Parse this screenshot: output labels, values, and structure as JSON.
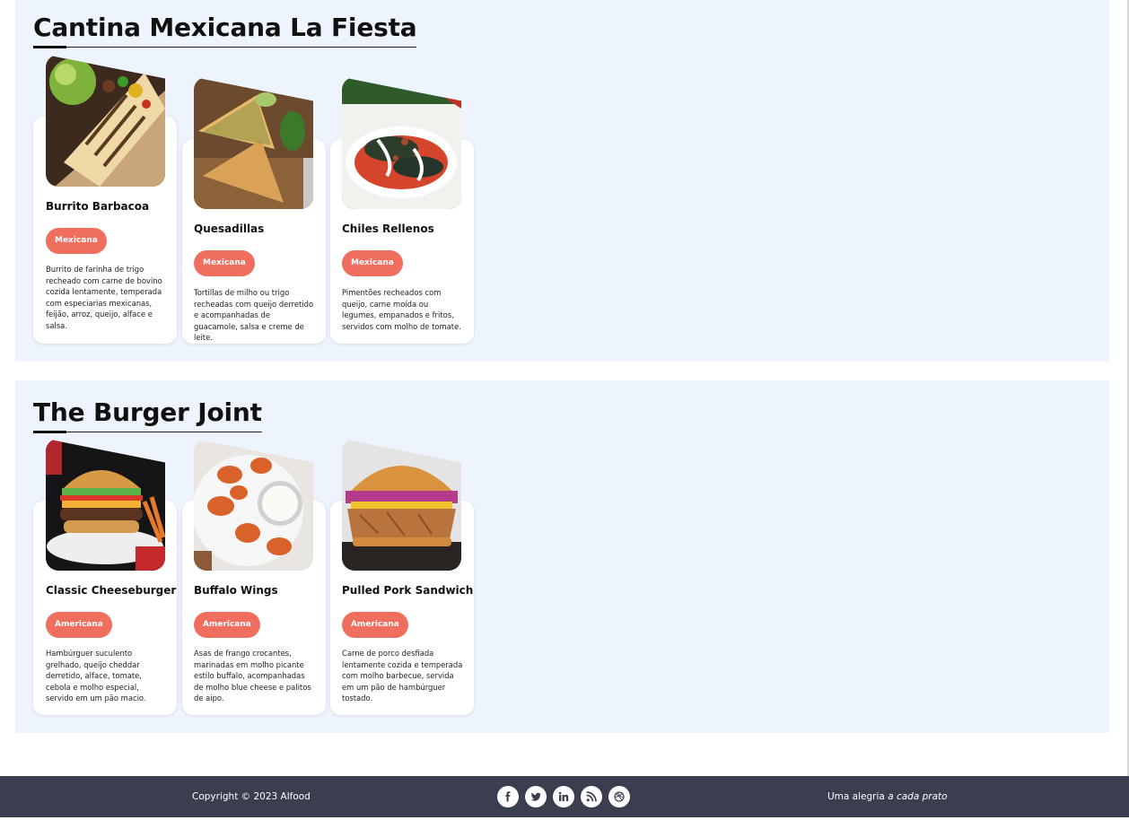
{
  "restaurants": [
    {
      "name": "Cantina Mexicana La Fiesta",
      "dishes": [
        {
          "name": "Burrito Barbacoa",
          "tag": "Mexicana",
          "description": "Burrito de farinha de trigo recheado com carne de bovino cozida lentamente, temperada com especiarias mexicanas, feijão, arroz, queijo, alface e salsa.",
          "image": "burrito-photo"
        },
        {
          "name": "Quesadillas",
          "tag": "Mexicana",
          "description": "Tortillas de milho ou trigo recheadas com queijo derretido e acompanhadas de guacamole, salsa e creme de leite.",
          "image": "quesadillas-photo"
        },
        {
          "name": "Chiles Rellenos",
          "tag": "Mexicana",
          "description": "Pimentões recheados com queijo, carne moída ou legumes, empanados e fritos, servidos com molho de tomate.",
          "image": "chiles-rellenos-photo"
        }
      ]
    },
    {
      "name": "The Burger Joint",
      "dishes": [
        {
          "name": "Classic Cheeseburger",
          "tag": "Americana",
          "description": "Hambúrguer suculento grelhado, queijo cheddar derretido, alface, tomate, cebola e molho especial, servido em um pão macio.",
          "image": "cheeseburger-photo"
        },
        {
          "name": "Buffalo Wings",
          "tag": "Americana",
          "description": "Asas de frango crocantes, marinadas em molho picante estilo buffalo, acompanhadas de molho blue cheese e palitos de aipo.",
          "image": "buffalo-wings-photo"
        },
        {
          "name": "Pulled Pork Sandwich",
          "tag": "Americana",
          "description": "Carne de porco desfiada lentamente cozida e temperada com molho barbecue, servida em um pão de hambúrguer tostado.",
          "image": "pulled-pork-photo"
        }
      ]
    }
  ],
  "footer": {
    "copyright": "Copyright © 2023 Alfood",
    "tagline_prefix": "Uma alegria",
    "tagline_emphasis": "a cada prato",
    "socials": [
      "facebook-icon",
      "twitter-icon",
      "linkedin-icon",
      "rss-icon",
      "dribbble-icon"
    ]
  },
  "colors": {
    "section_bg": "#eef4fd",
    "tag_bg": "#ef6e5e",
    "footer_bg": "#3a3e4f"
  }
}
